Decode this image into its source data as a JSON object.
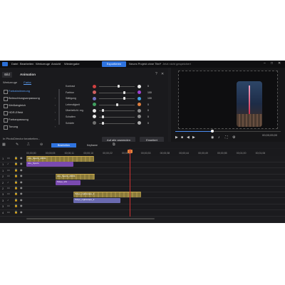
{
  "menu": {
    "items": [
      "Datei",
      "Bearbeiten",
      "Werkzeuge",
      "Ansicht",
      "Wiedergabe"
    ],
    "export_label": "Exportieren",
    "project_title": "Neues Projekt ohne Titel*",
    "project_status": "Jetzt nicht gespeichert"
  },
  "panel": {
    "tab_image": "Bild",
    "tab_animation": "Animation",
    "subtab_tools": "Werkzeuge",
    "subtab_color": "Farbe",
    "list": [
      "Farbabstimmung",
      "Beleuchtungsanpassung",
      "Weißabgleich",
      "HDR-Effekt",
      "Farbanpassung",
      "Tonung"
    ],
    "edit_in_link": "In PhotoDirector bearbeiten...",
    "apply_all": "Auf alle anwenden",
    "reset": "Erweitert"
  },
  "adjust": [
    {
      "label": "Kontrast",
      "value": "0",
      "pos": 0.55,
      "c1": "#d04040",
      "c2": "#e8e8e8"
    },
    {
      "label": "Farbton",
      "value": "100",
      "pos": 0.7,
      "c1": "#d06060",
      "c2": "#a040d0"
    },
    {
      "label": "Sättigung",
      "value": "100",
      "pos": 0.7,
      "c1": "#7070c0",
      "c2": "#40a0e0"
    },
    {
      "label": "Lebendigkeit",
      "value": "0",
      "pos": 0.5,
      "c1": "#40a060",
      "c2": "#e08040"
    },
    {
      "label": "Überbelicht. reg.",
      "value": "0",
      "pos": 0.1,
      "c1": "#e8e8e8",
      "c2": "#8a8a8a"
    },
    {
      "label": "Schatten",
      "value": "0",
      "pos": 0.1,
      "c1": "#e8e8e8",
      "c2": "#8a8a8a"
    },
    {
      "label": "Schärfe",
      "value": "0",
      "pos": 0.1,
      "c1": "#707070",
      "c2": "#b0b0b0"
    }
  ],
  "preview": {
    "progress": 0.35,
    "timecode": "00;00;05;00"
  },
  "timeline": {
    "tab_edit": "Bearbeiten",
    "tab_keyframe": "Keyframe",
    "ruler": [
      "00;00;00",
      "00;00;05",
      "00;00;11",
      "00;00;16",
      "00;00;22",
      "00;00;27",
      "00;00;33",
      "00;00;38",
      "00;00;44",
      "00;00;49",
      "00;00;55",
      "00;01;00",
      "00;01;06"
    ],
    "clips": [
      {
        "label": "ALL_Sports_20231",
        "type": "video",
        "track": 0
      },
      {
        "label": "ALL_Sports",
        "type": "audio",
        "track": 1
      },
      {
        "label": "ALL_Sports_20231",
        "type": "video",
        "track": 3
      },
      {
        "label": "Tokyo_Vid",
        "type": "audio",
        "track": 4
      },
      {
        "label": "Tokyo_nightscape_2",
        "type": "video",
        "track": 6
      },
      {
        "label": "Tokyo_nightscape_2",
        "type": "audio2",
        "track": 7
      }
    ]
  },
  "colors": {
    "accent": "#2f74e0",
    "playhead": "#d03030"
  }
}
